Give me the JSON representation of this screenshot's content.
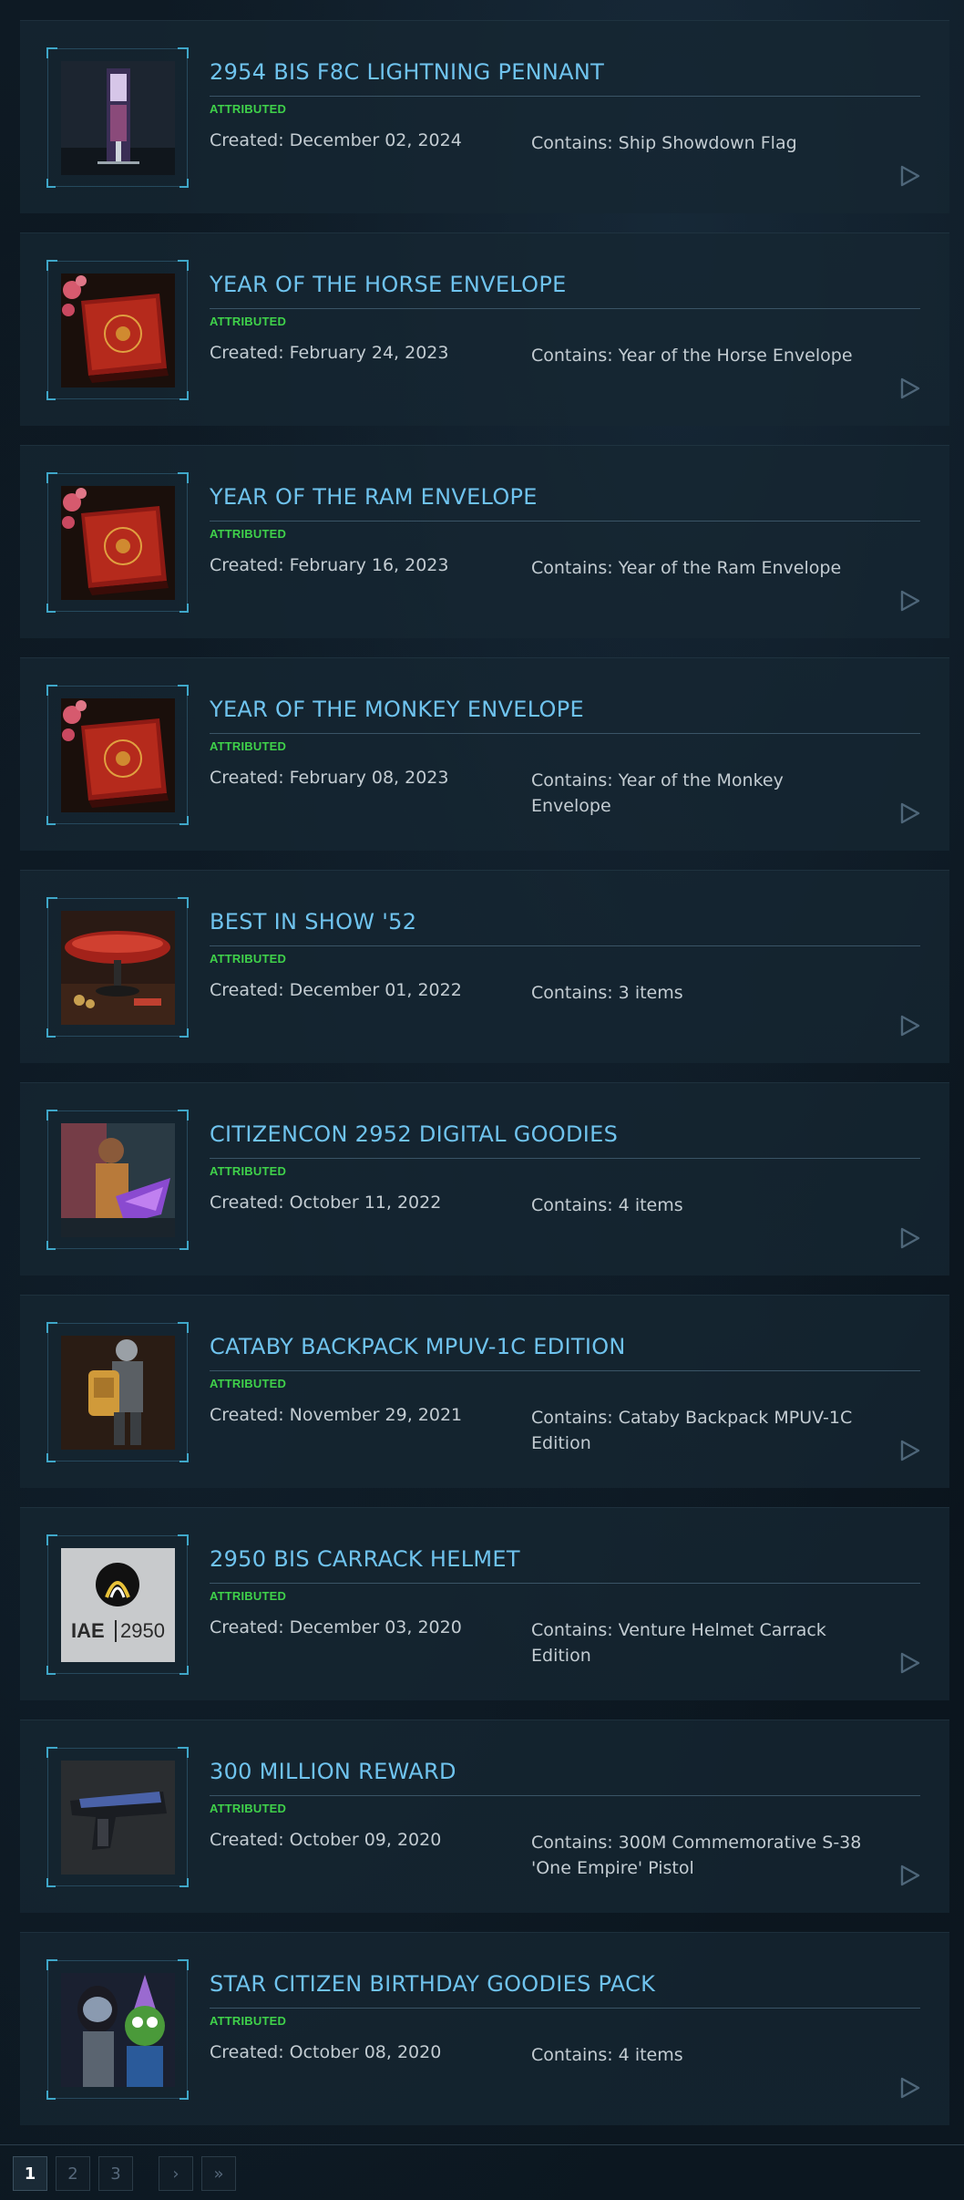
{
  "items": [
    {
      "title": "2954 BIS F8C LIGHTNING PENNANT",
      "status": "ATTRIBUTED",
      "created": "Created: December 02, 2024",
      "contains": "Contains: Ship Showdown Flag",
      "thumb": "pennant-thumbnail"
    },
    {
      "title": "YEAR OF THE HORSE ENVELOPE",
      "status": "ATTRIBUTED",
      "created": "Created: February 24, 2023",
      "contains": "Contains: Year of the Horse Envelope",
      "thumb": "red-envelope-thumbnail"
    },
    {
      "title": "YEAR OF THE RAM ENVELOPE",
      "status": "ATTRIBUTED",
      "created": "Created: February 16, 2023",
      "contains": "Contains: Year of the Ram Envelope",
      "thumb": "red-envelope-thumbnail"
    },
    {
      "title": "YEAR OF THE MONKEY ENVELOPE",
      "status": "ATTRIBUTED",
      "created": "Created: February 08, 2023",
      "contains": "Contains: Year of the Monkey Envelope",
      "thumb": "red-envelope-thumbnail"
    },
    {
      "title": "BEST IN SHOW '52",
      "status": "ATTRIBUTED",
      "created": "Created: December 01, 2022",
      "contains": "Contains: 3 items",
      "thumb": "trophy-ship-thumbnail"
    },
    {
      "title": "CITIZENCON 2952 DIGITAL GOODIES",
      "status": "ATTRIBUTED",
      "created": "Created: October 11, 2022",
      "contains": "Contains: 4 items",
      "thumb": "character-thumbnail"
    },
    {
      "title": "CATABY BACKPACK MPUV-1C EDITION",
      "status": "ATTRIBUTED",
      "created": "Created: November 29, 2021",
      "contains": "Contains: Cataby Backpack MPUV-1C Edition",
      "thumb": "backpack-thumbnail"
    },
    {
      "title": "2950 BIS CARRACK HELMET",
      "status": "ATTRIBUTED",
      "created": "Created: December 03, 2020",
      "contains": "Contains: Venture Helmet Carrack Edition",
      "thumb": "iae-logo-thumbnail"
    },
    {
      "title": "300 MILLION REWARD",
      "status": "ATTRIBUTED",
      "created": "Created: October 09, 2020",
      "contains": "Contains: 300M Commemorative S-38 'One Empire' Pistol",
      "thumb": "pistol-thumbnail"
    },
    {
      "title": "STAR CITIZEN BIRTHDAY GOODIES PACK",
      "status": "ATTRIBUTED",
      "created": "Created: October 08, 2020",
      "contains": "Contains: 4 items",
      "thumb": "birthday-thumbnail"
    }
  ],
  "iae_logo": {
    "left": "IAE",
    "right": "2950"
  },
  "pagination": {
    "pages": [
      "1",
      "2",
      "3"
    ],
    "active": "1",
    "next": "›",
    "last": "»"
  },
  "colors": {
    "title": "#6fc3ee",
    "status": "#3fd14a",
    "accent": "#3fa7c9",
    "card": "#162632"
  }
}
